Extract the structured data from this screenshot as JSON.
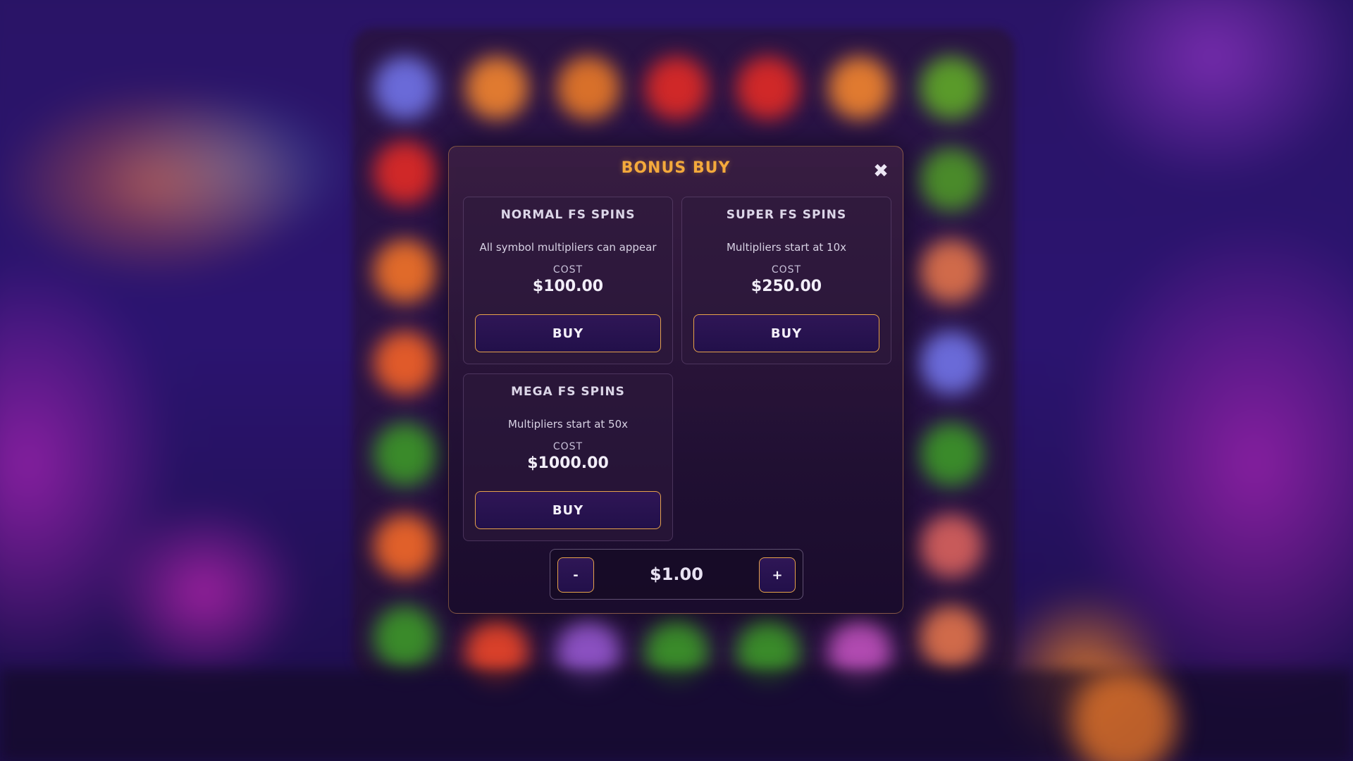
{
  "modal": {
    "title": "BONUS BUY",
    "close_icon": "close-icon",
    "accent_color": "#f4a93c"
  },
  "options": [
    {
      "title": "NORMAL FS SPINS",
      "description": "All symbol multipliers can appear",
      "cost_label": "COST",
      "cost": "$100.00",
      "buy_label": "BUY"
    },
    {
      "title": "SUPER FS SPINS",
      "description": "Multipliers start at 10x",
      "cost_label": "COST",
      "cost": "$250.00",
      "buy_label": "BUY"
    },
    {
      "title": "MEGA FS SPINS",
      "description": "Multipliers start at 50x",
      "cost_label": "COST",
      "cost": "$1000.00",
      "buy_label": "BUY"
    }
  ],
  "bet": {
    "minus_label": "-",
    "value": "$1.00",
    "plus_label": "+"
  }
}
